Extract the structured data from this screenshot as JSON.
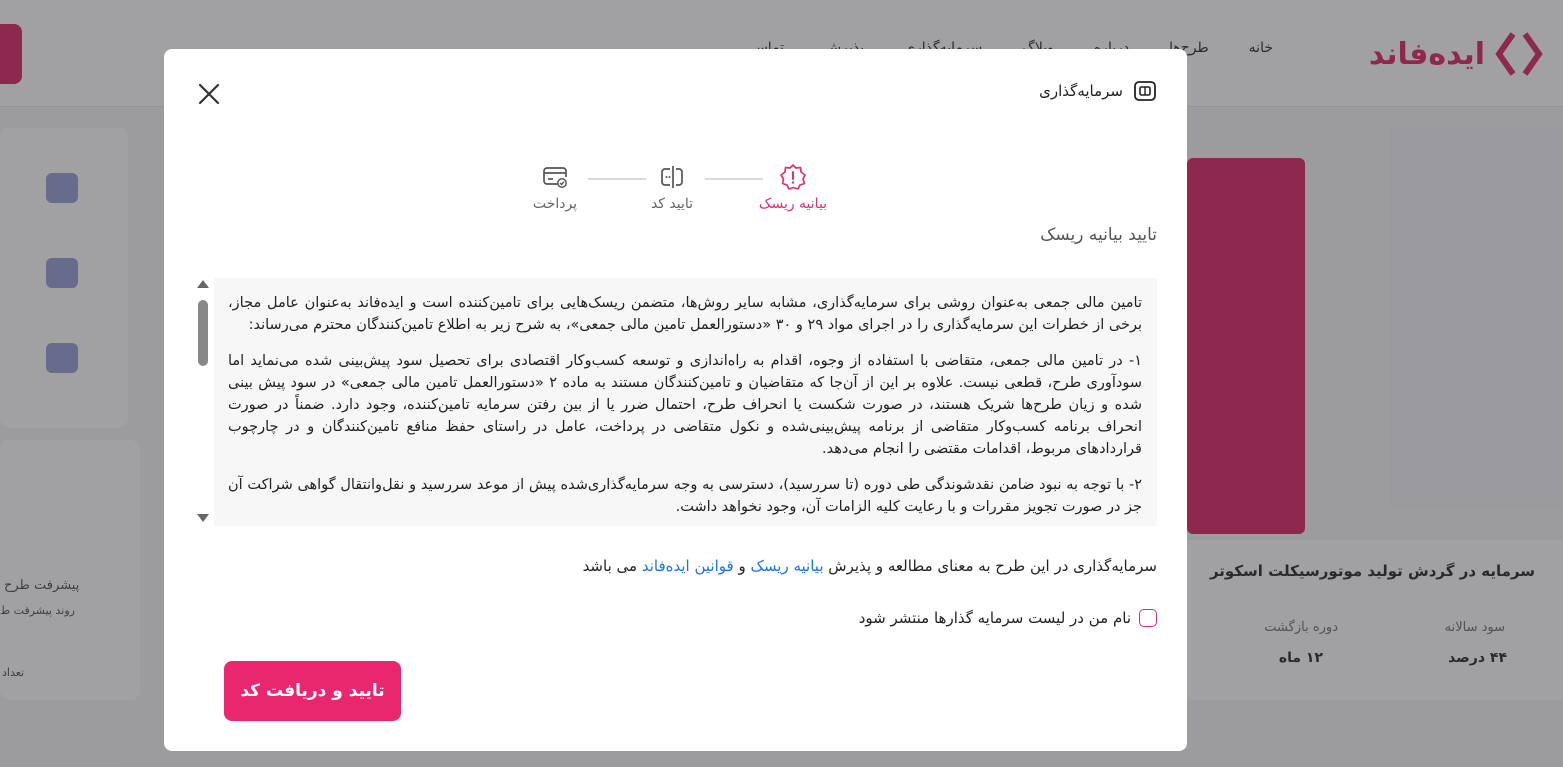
{
  "background": {
    "logo_text": "ایده‌فاند",
    "nav": [
      "خانه",
      "طرح‌ها",
      "درباره",
      "وبلاگ",
      "سرمایه‌گذاری",
      "پذیرش",
      "تماس"
    ],
    "project_title": "سرمایه در گردش تولید موتورسیکلت اسکوتر",
    "stats": [
      {
        "label": "سود سالانه",
        "value": "۴۴ درصد"
      },
      {
        "label": "دوره بازگشت",
        "value": "۱۲ ماه"
      }
    ],
    "side_texts": [
      "پیشرفت طرح",
      "روند پیشرفت ط",
      "تعداد"
    ]
  },
  "modal": {
    "title": "سرمایه‌گذاری",
    "title_icon": "investment-card-icon",
    "close_icon": "close-icon",
    "steps": [
      {
        "label": "بیانیه ریسک",
        "icon": "warning-badge-icon",
        "active": true
      },
      {
        "label": "تایید کد",
        "icon": "code-input-icon",
        "active": false
      },
      {
        "label": "پرداخت",
        "icon": "card-check-icon",
        "active": false
      }
    ],
    "section_title": "تایید بیانیه ریسک",
    "terms": [
      "تامین مالی جمعی به‌عنوان روشی برای سرمایه‌گذاری، مشابه سایر روش‌ها، متضمن ریسک‌هایی برای تامین‌کننده است و ایده‌فاند به‌عنوان عامل مجاز، برخی از خطرات این سرمایه‌گذاری را در اجرای مواد ۲۹ و ۳۰ «دستورالعمل تامین مالی جمعی»، به شرح زیر به اطلاع تامین‌کنندگان محترم می‌رساند:",
      "۱- در تامین مالی جمعی، متقاضی با استفاده از وجوه، اقدام به راه‌اندازی و توسعه کسب‌وکار اقتصادی برای تحصیل سود پیش‌بینی شده می‌نماید اما سودآوری طرح، قطعی نیست. علاوه بر این از آن‌جا که متقاضیان و تامین‌کنندگان مستند به ماده ۲ «دستورالعمل تامین مالی جمعی» در سود پیش بینی شده و زیان طرح‌ها شریک هستند، در صورت شکست یا انحراف طرح، احتمال ضرر یا از بین رفتن سرمایه تامین‌کننده، وجود دارد. ضمناً در صورت انحراف برنامه کسب‌وکار متقاضی از برنامه پیش‌بینی‌شده و نکول متقاضی در پرداخت، عامل در راستای حفظ منافع تامین‌کنندگان و در چارچوب قراردادهای مربوط، اقدامات مقتضی را انجام می‌دهد.",
      "۲- با توجه به نبود ضامن نقدشوندگی طی دوره (تا سررسید)، دسترسی به وجه سرمایه‌گذاری‌شده پیش از موعد سررسید و نقل‌وانتقال گواهی شراکت آن جز در صورت تجویز مقررات و با رعایت کلیه الزامات آن، وجود نخواهد داشت."
    ],
    "agreement": {
      "prefix": "سرمایه‌گذاری در این طرح به معنای مطالعه و پذیرش",
      "link_risk": "بیانیه ریسک",
      "and": "و",
      "link_rules": "قوانین ایده‌فاند",
      "suffix": "می باشد"
    },
    "checkbox_label": "نام من در لیست سرمایه گذارها منتشر شود",
    "checkbox_checked": false,
    "confirm_button": "تایید و دریافت کد",
    "accent_color": "#e8276e",
    "link_color": "#1a73e8"
  }
}
